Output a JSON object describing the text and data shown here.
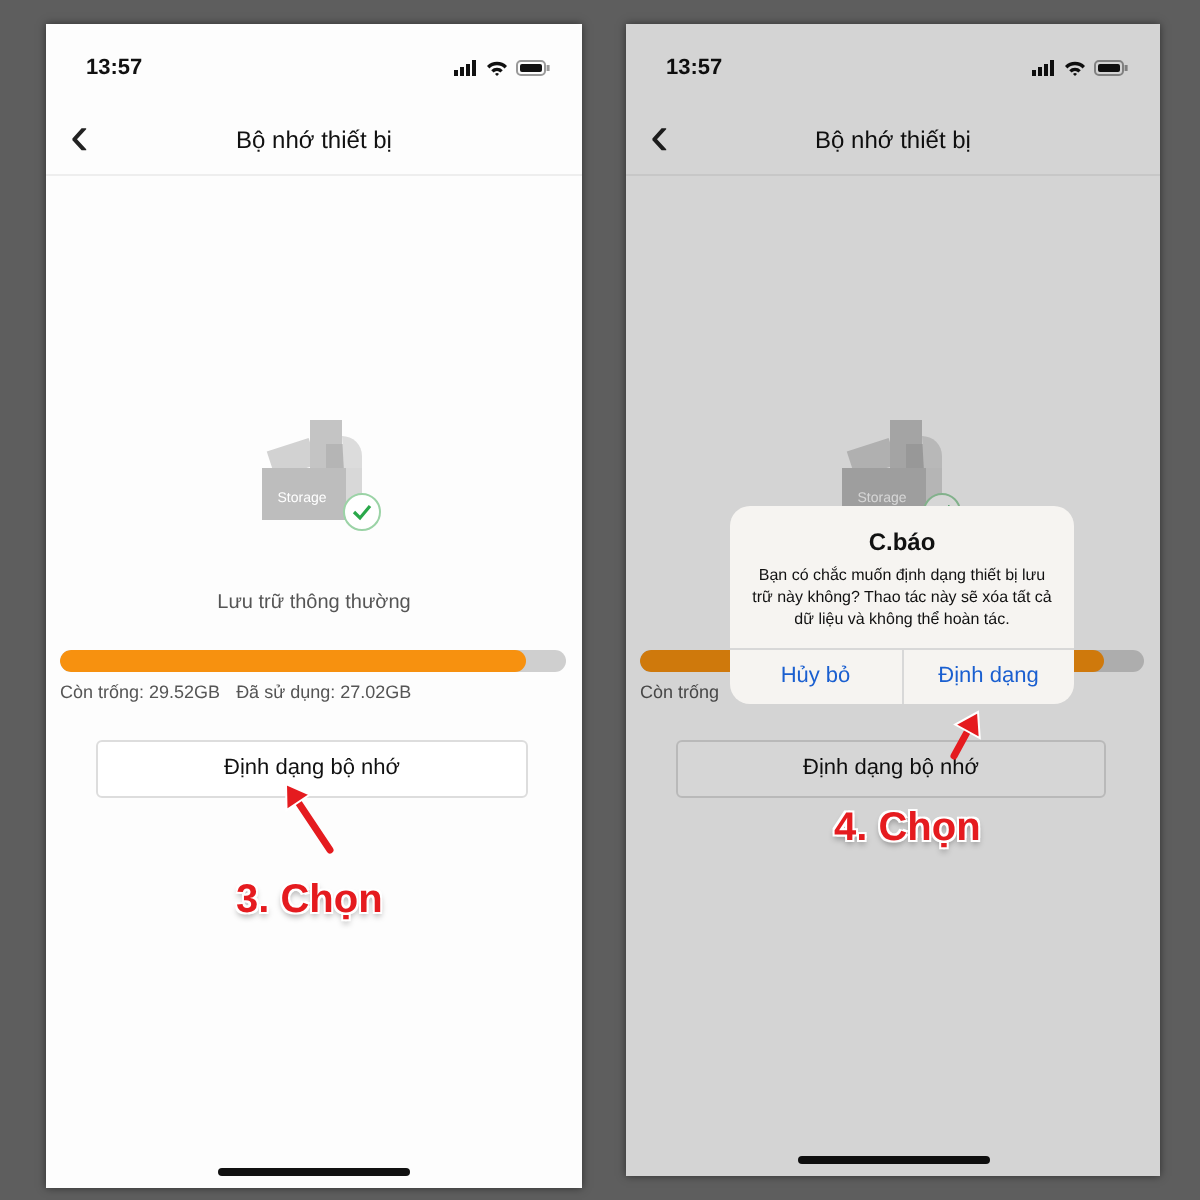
{
  "screens": [
    {
      "dimmed": false,
      "status_time": "13:57",
      "title": "Bộ nhớ thiết bị",
      "back": "‹",
      "box_label": "Storage",
      "storage_label": "Lưu trữ thông thường",
      "level": 0.92,
      "stats": [
        "Còn trống: 29.52GB",
        "Đã sử dụng: 27.02GB"
      ],
      "format_button": "Định dạng bộ nhớ",
      "annotation": "3. Chọn"
    },
    {
      "dimmed": true,
      "status_time": "13:57",
      "title": "Bộ nhớ thiết bị",
      "back": "‹",
      "box_label": "Storage",
      "level": 0.92,
      "stats": [
        "Còn trống"
      ],
      "format_button": "Định dạng bộ nhớ",
      "annotation": "4. Chọn",
      "dialog": {
        "title": "C.báo",
        "message": "Bạn có chắc muốn định dạng thiết bị lưu trữ này không? Thao tác này sẽ xóa tất cả dữ liệu và không thể hoàn tác.",
        "buttons": [
          "Hủy bỏ",
          "Định dạng"
        ]
      }
    }
  ]
}
